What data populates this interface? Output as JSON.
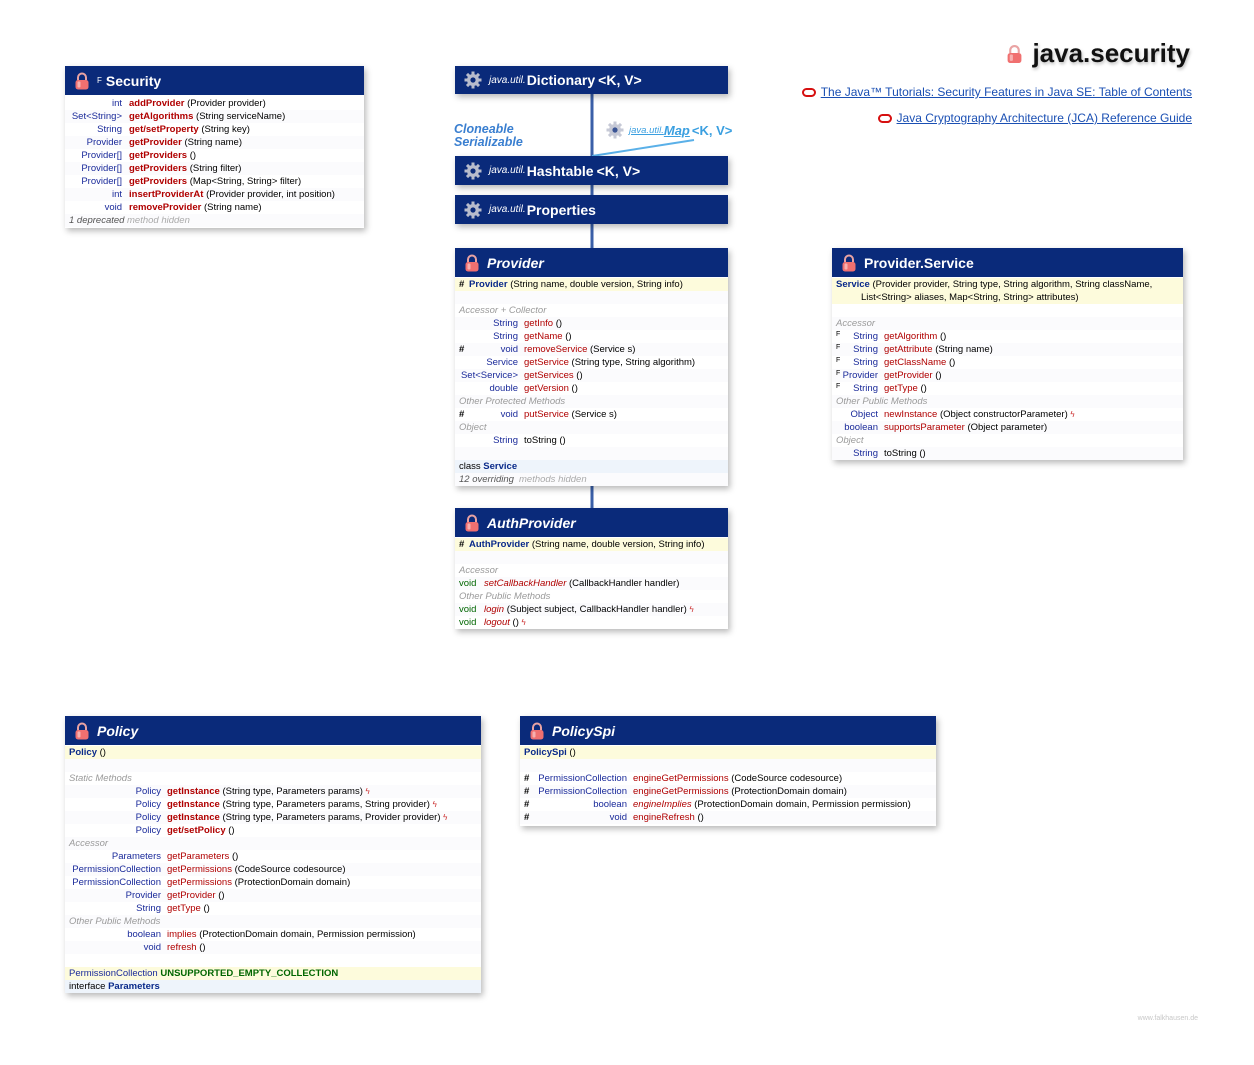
{
  "package": {
    "title": "java.security"
  },
  "links": [
    "The Java™ Tutorials: Security Features in Java SE: Table of Contents",
    "Java Cryptography Architecture (JCA) Reference Guide"
  ],
  "interfaces_label": {
    "line1": "Cloneable",
    "line2": "Serializable"
  },
  "dictionary": {
    "pkg": "java.util.",
    "name": "Dictionary",
    "generics": "<K, V>"
  },
  "map": {
    "pkg": "java.util.",
    "name": "Map",
    "generics": "<K, V>"
  },
  "hashtable": {
    "pkg": "java.util.",
    "name": "Hashtable",
    "generics": "<K, V>"
  },
  "properties": {
    "pkg": "java.util.",
    "name": "Properties"
  },
  "security": {
    "final_mark": "F",
    "name": "Security",
    "rows": [
      {
        "type": "int",
        "name": "addProvider",
        "args": "(Provider provider)"
      },
      {
        "type": "Set<String>",
        "name": "getAlgorithms",
        "args": "(String serviceName)"
      },
      {
        "type": "String",
        "name": "get/setProperty",
        "args": "(String key)"
      },
      {
        "type": "Provider",
        "name": "getProvider",
        "args": "(String name)"
      },
      {
        "type": "Provider[]",
        "name": "getProviders",
        "args": "()"
      },
      {
        "type": "Provider[]",
        "name": "getProviders",
        "args": "(String filter)"
      },
      {
        "type": "Provider[]",
        "name": "getProviders",
        "args": "(Map<String, String> filter)"
      },
      {
        "type": "int",
        "name": "insertProviderAt",
        "args": "(Provider provider, int position)"
      },
      {
        "type": "void",
        "name": "removeProvider",
        "args": "(String name)"
      }
    ],
    "footer_a": "1 deprecated",
    "footer_b": "method hidden"
  },
  "provider": {
    "name": "Provider",
    "ctor_hash": "#",
    "ctor": "Provider",
    "ctor_args": "(String name, double version, String info)",
    "sec_accessor": "Accessor + Collector",
    "rows": [
      {
        "hash": "",
        "type": "String",
        "name": "getInfo",
        "args": "()"
      },
      {
        "hash": "",
        "type": "String",
        "name": "getName",
        "args": "()"
      },
      {
        "hash": "#",
        "type": "void",
        "name": "removeService",
        "args": "(Service s)"
      },
      {
        "hash": "",
        "type": "Service",
        "name": "getService",
        "args": "(String type, String algorithm)"
      },
      {
        "hash": "",
        "type": "Set<Service>",
        "name": "getServices",
        "args": "()"
      },
      {
        "hash": "",
        "type": "double",
        "name": "getVersion",
        "args": "()"
      }
    ],
    "sec_protected": "Other Protected Methods",
    "put_hash": "#",
    "put_type": "void",
    "put_name": "putService",
    "put_args": "(Service s)",
    "sec_object": "Object",
    "tostring_type": "String",
    "tostring_name": "toString",
    "tostring_args": "()",
    "nested_kw": "class",
    "nested_name": "Service",
    "footer_a": "12 overriding",
    "footer_b": "methods hidden"
  },
  "authprovider": {
    "name": "AuthProvider",
    "ctor_hash": "#",
    "ctor": "AuthProvider",
    "ctor_args": "(String name, double version, String info)",
    "sec_accessor": "Accessor",
    "setcb_type": "void",
    "setcb_name": "setCallbackHandler",
    "setcb_args": "(CallbackHandler handler)",
    "sec_public": "Other Public Methods",
    "login_type": "void",
    "login_name": "login",
    "login_args": "(Subject subject, CallbackHandler handler)",
    "logout_type": "void",
    "logout_name": "logout",
    "logout_args": "()",
    "ex_mark": "ϟ"
  },
  "providerservice": {
    "name": "Provider.Service",
    "ctor": "Service",
    "ctor_args1": "(Provider provider, String type, String algorithm, String className,",
    "ctor_args2": "List<String> aliases, Map<String, String> attributes)",
    "sec_accessor": "Accessor",
    "final_mark": "F",
    "rows": [
      {
        "type": "String",
        "name": "getAlgorithm",
        "args": "()"
      },
      {
        "type": "String",
        "name": "getAttribute",
        "args": "(String name)"
      },
      {
        "type": "String",
        "name": "getClassName",
        "args": "()"
      },
      {
        "type": "Provider",
        "name": "getProvider",
        "args": "()"
      },
      {
        "type": "String",
        "name": "getType",
        "args": "()"
      }
    ],
    "sec_public": "Other Public Methods",
    "ni_type": "Object",
    "ni_name": "newInstance",
    "ni_args": "(Object constructorParameter)",
    "sp_type": "boolean",
    "sp_name": "supportsParameter",
    "sp_args": "(Object parameter)",
    "sec_object": "Object",
    "ts_type": "String",
    "ts_name": "toString",
    "ts_args": "()",
    "ex_mark": "ϟ"
  },
  "policy": {
    "name": "Policy",
    "ctor": "Policy",
    "ctor_args": "()",
    "sec_static": "Static Methods",
    "static_rows": [
      {
        "type": "Policy",
        "name": "getInstance",
        "args": "(String type, Parameters params)",
        "ex": "ϟ"
      },
      {
        "type": "Policy",
        "name": "getInstance",
        "args": "(String type, Parameters params, String provider)",
        "ex": "ϟ"
      },
      {
        "type": "Policy",
        "name": "getInstance",
        "args": "(String type, Parameters params, Provider provider)",
        "ex": "ϟ"
      },
      {
        "type": "Policy",
        "name": "get/setPolicy",
        "args": "()",
        "ex": ""
      }
    ],
    "sec_accessor": "Accessor",
    "accessor_rows": [
      {
        "type": "Parameters",
        "name": "getParameters",
        "args": "()"
      },
      {
        "type": "PermissionCollection",
        "name": "getPermissions",
        "args": "(CodeSource codesource)"
      },
      {
        "type": "PermissionCollection",
        "name": "getPermissions",
        "args": "(ProtectionDomain domain)"
      },
      {
        "type": "Provider",
        "name": "getProvider",
        "args": "()"
      },
      {
        "type": "String",
        "name": "getType",
        "args": "()"
      }
    ],
    "sec_public": "Other Public Methods",
    "public_rows": [
      {
        "type": "boolean",
        "name": "implies",
        "args": "(ProtectionDomain domain, Permission permission)"
      },
      {
        "type": "void",
        "name": "refresh",
        "args": "()"
      }
    ],
    "const_type": "PermissionCollection",
    "const_name": "UNSUPPORTED_EMPTY_COLLECTION",
    "nested_kw": "interface",
    "nested_name": "Parameters"
  },
  "policyspi": {
    "name": "PolicySpi",
    "ctor": "PolicySpi",
    "ctor_args": "()",
    "rows": [
      {
        "hash": "#",
        "type": "PermissionCollection",
        "name": "engineGetPermissions",
        "args": "(CodeSource codesource)"
      },
      {
        "hash": "#",
        "type": "PermissionCollection",
        "name": "engineGetPermissions",
        "args": "(ProtectionDomain domain)"
      },
      {
        "hash": "#",
        "type": "boolean",
        "name": "engineImplies",
        "args": "(ProtectionDomain domain, Permission permission)"
      },
      {
        "hash": "#",
        "type": "void",
        "name": "engineRefresh",
        "args": "()"
      }
    ]
  },
  "watermark": "www.falkhausen.de"
}
